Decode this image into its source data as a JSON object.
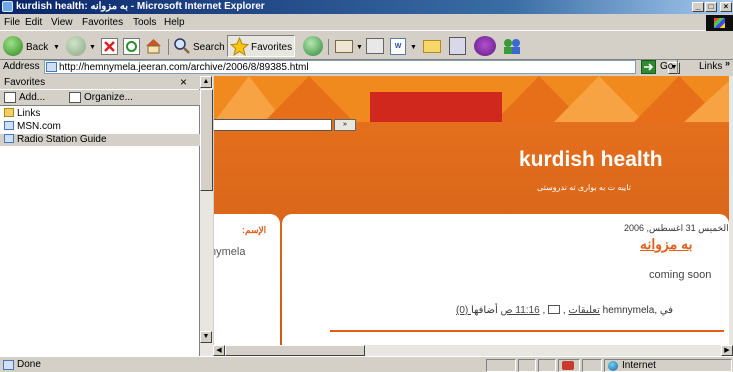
{
  "window": {
    "title": "kurdish health: به مزوانه - Microsoft Internet Explorer",
    "minimize": "_",
    "maximize": "□",
    "close": "×"
  },
  "menu": {
    "items": [
      "File",
      "Edit",
      "View",
      "Favorites",
      "Tools",
      "Help"
    ]
  },
  "toolbar": {
    "back_label": "Back",
    "search_label": "Search",
    "favorites_label": "Favorites"
  },
  "address_bar": {
    "label": "Address",
    "url": "http://hemnymela.jeeran.com/archive/2006/8/89385.html",
    "go_label": "Go",
    "links_label": "Links"
  },
  "favorites_pane": {
    "title": "Favorites",
    "add_label": "Add...",
    "organize_label": "Organize...",
    "items": [
      {
        "label": "Links",
        "type": "folder"
      },
      {
        "label": "MSN.com",
        "type": "page"
      },
      {
        "label": "Radio Station Guide",
        "type": "page",
        "selected": true
      }
    ]
  },
  "page": {
    "search_button": "»",
    "blog_title": "kurdish health",
    "blog_subtitle": "تایبه ت به بواری ته ندروستی",
    "sidebar_title": "الإسم:",
    "sidebar_name": "hymela",
    "post": {
      "date": "الخميس 31 اغسطس, 2006",
      "title": "به مزوانه",
      "body": "coming soon",
      "footer_author": "أضافها hemnymela, في",
      "footer_time": "11:16 ص",
      "footer_comments": "(0) تعليقات"
    }
  },
  "statusbar": {
    "status": "Done",
    "zone": "Internet"
  }
}
